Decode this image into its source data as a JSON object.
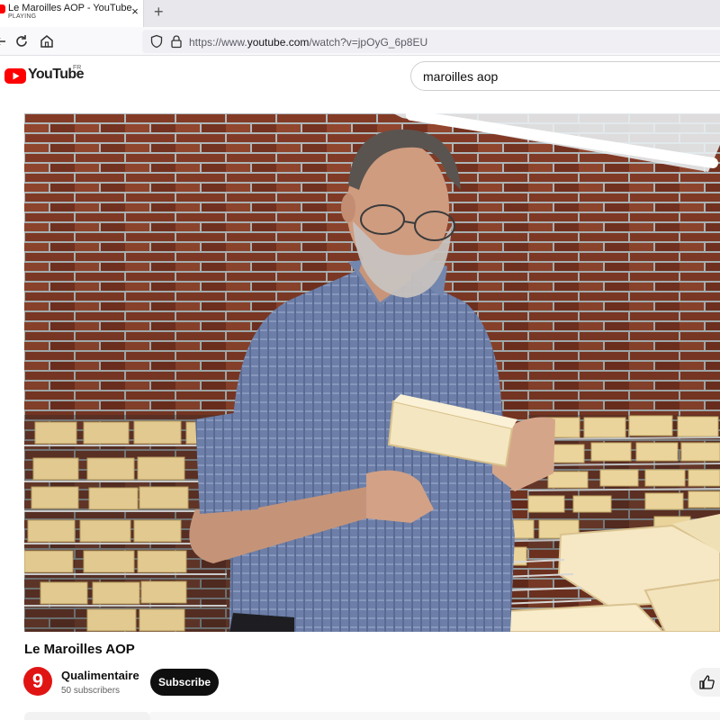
{
  "browser": {
    "tab": {
      "title": "Le Maroilles AOP - YouTube",
      "status": "PLAYING",
      "close_glyph": "×"
    },
    "new_tab_glyph": "+",
    "url": {
      "prefix": "https://www.",
      "host": "youtube.com",
      "path": "/watch?v=jpOyG_6p8EU"
    },
    "icons": [
      "reload-icon",
      "home-icon",
      "shield-icon",
      "lock-icon"
    ]
  },
  "youtube": {
    "logo_text": "YouTube",
    "country_code": "FR",
    "search_query": "maroilles aop",
    "brand_color": "#ff0000"
  },
  "video": {
    "title": "Le Maroilles AOP",
    "channel": {
      "name": "Qualimentaire",
      "subscribers": "50 subscribers",
      "avatar_glyph": "9",
      "avatar_color": "#e11414"
    },
    "subscribe_label": "Subscribe",
    "like_icon": "thumbs-up-icon"
  }
}
